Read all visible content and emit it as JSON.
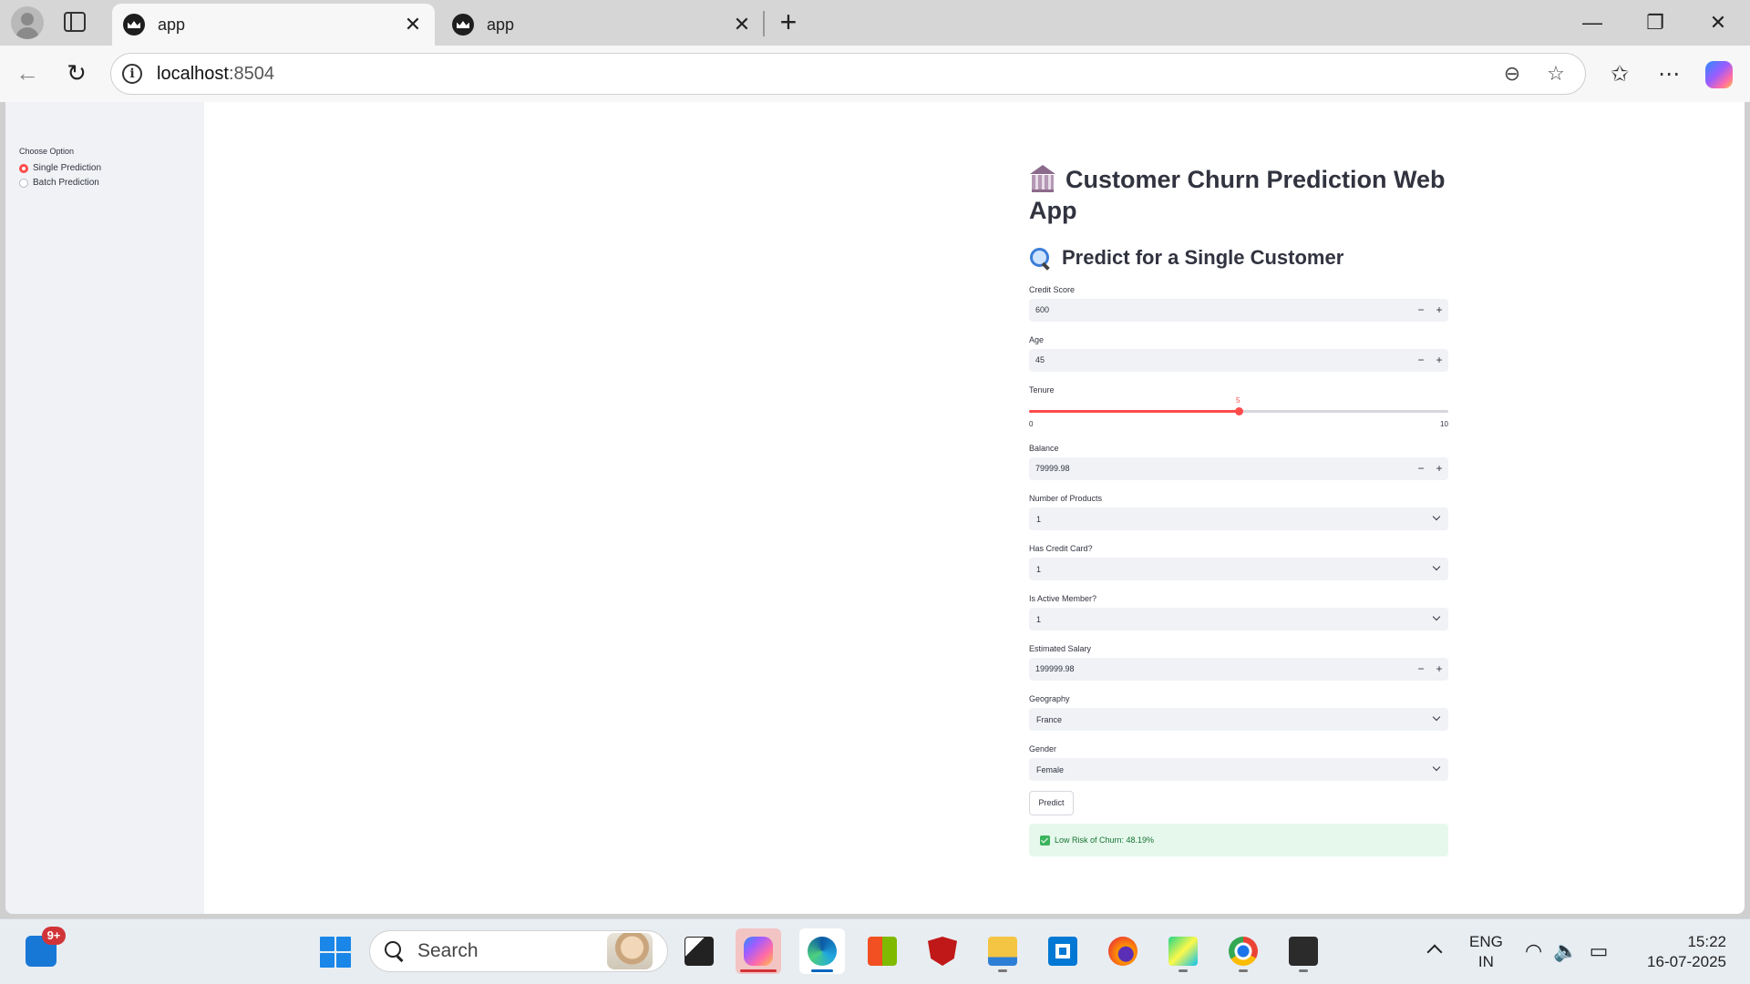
{
  "browser": {
    "tabs": [
      {
        "title": "app",
        "close": "✕"
      },
      {
        "title": "app",
        "close": "✕"
      }
    ],
    "new_tab": "+",
    "window_controls": {
      "minimize": "—",
      "restore": "❐",
      "close": "✕"
    },
    "url_host": "localhost",
    "url_port": ":8504"
  },
  "sidebar": {
    "label": "Choose Option",
    "options": [
      {
        "label": "Single Prediction",
        "selected": true
      },
      {
        "label": "Batch Prediction",
        "selected": false
      }
    ]
  },
  "main": {
    "title": "Customer Churn Prediction Web App",
    "subtitle": "Predict for a Single Customer",
    "fields": {
      "credit_score": {
        "label": "Credit Score",
        "value": "600"
      },
      "age": {
        "label": "Age",
        "value": "45"
      },
      "tenure": {
        "label": "Tenure",
        "value": "5",
        "min": "0",
        "max": "10",
        "fraction": 0.5
      },
      "balance": {
        "label": "Balance",
        "value": "79999.98"
      },
      "num_products": {
        "label": "Number of Products",
        "value": "1"
      },
      "has_credit_card": {
        "label": "Has Credit Card?",
        "value": "1"
      },
      "is_active": {
        "label": "Is Active Member?",
        "value": "1"
      },
      "salary": {
        "label": "Estimated Salary",
        "value": "199999.98"
      },
      "geography": {
        "label": "Geography",
        "value": "France"
      },
      "gender": {
        "label": "Gender",
        "value": "Female"
      }
    },
    "stepper": {
      "minus": "−",
      "plus": "+"
    },
    "predict_label": "Predict",
    "result": "Low Risk of Churn: 48.19%"
  },
  "taskbar": {
    "search_placeholder": "Search",
    "widgets_badge": "9+",
    "language": [
      "ENG",
      "IN"
    ],
    "time": "15:22",
    "date": "16-07-2025"
  },
  "colors": {
    "accent": "#ff4b4b",
    "success_bg": "#e6f8ec",
    "success_text": "#177233"
  }
}
